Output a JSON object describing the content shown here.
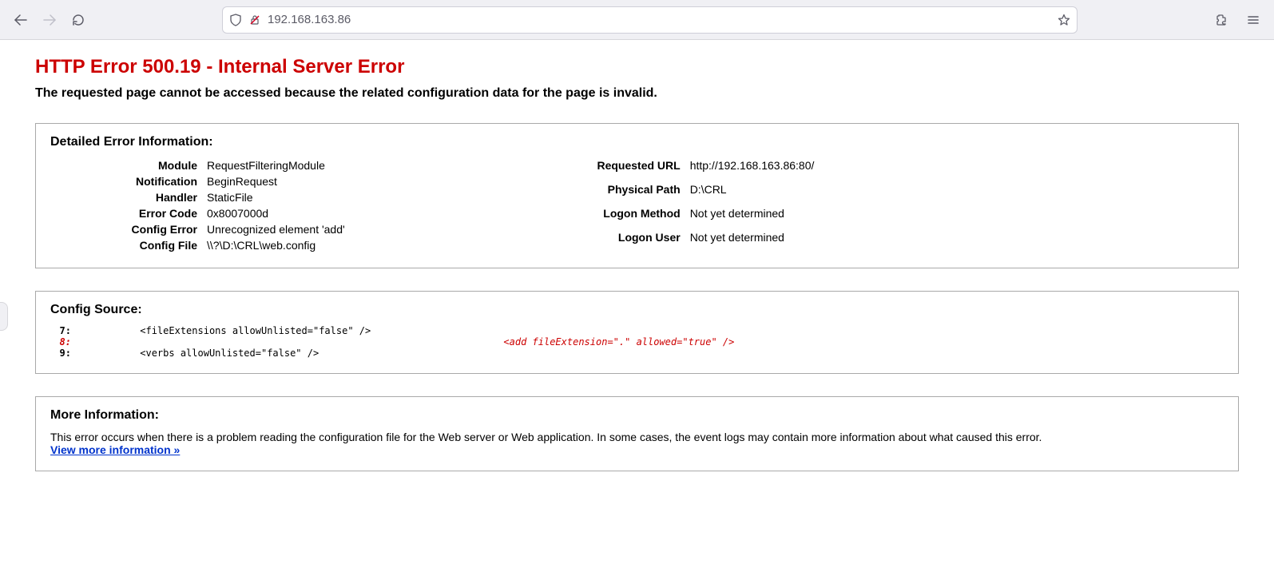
{
  "browser": {
    "url": "192.168.163.86"
  },
  "error": {
    "title": "HTTP Error 500.19 - Internal Server Error",
    "subtitle": "The requested page cannot be accessed because the related configuration data for the page is invalid."
  },
  "detail_section": {
    "heading": "Detailed Error Information:",
    "left": [
      {
        "label": "Module",
        "value": "RequestFilteringModule"
      },
      {
        "label": "Notification",
        "value": "BeginRequest"
      },
      {
        "label": "Handler",
        "value": "StaticFile"
      },
      {
        "label": "Error Code",
        "value": "0x8007000d"
      },
      {
        "label": "Config Error",
        "value": "Unrecognized element 'add'"
      },
      {
        "label": "Config File",
        "value": "\\\\?\\D:\\CRL\\web.config"
      }
    ],
    "right": [
      {
        "label": "Requested URL",
        "value": "http://192.168.163.86:80/"
      },
      {
        "label": "Physical Path",
        "value": "D:\\CRL"
      },
      {
        "label": "Logon Method",
        "value": "Not yet determined"
      },
      {
        "label": "Logon User",
        "value": "Not yet determined"
      }
    ]
  },
  "config_source": {
    "heading": "Config Source:",
    "lines": [
      {
        "no": "7:",
        "text": "          <fileExtensions allowUnlisted=\"false\" />",
        "err": false
      },
      {
        "no": "8:",
        "text": "                                                                         <add fileExtension=\".\" allowed=\"true\" />",
        "err": true
      },
      {
        "no": "9:",
        "text": "          <verbs allowUnlisted=\"false\" />",
        "err": false
      }
    ]
  },
  "more_info": {
    "heading": "More Information:",
    "text": "This error occurs when there is a problem reading the configuration file for the Web server or Web application. In some cases, the event logs may contain more information about what caused this error.",
    "link": "View more information »"
  }
}
